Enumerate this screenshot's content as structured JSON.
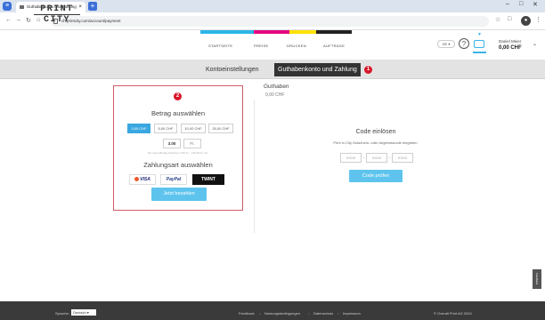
{
  "browser": {
    "tab_title": "Guthabenkonto und Zahlung",
    "tab_close": "×",
    "new_tab": "+",
    "menu_icon": "≡",
    "url": "ch.printcity.com/account/payment",
    "nav": {
      "back": "←",
      "forward": "→",
      "reload": "↻",
      "home": "⌂"
    },
    "star": "☆",
    "ext": "□",
    "profile_initial": "●",
    "more": "⋮",
    "win_min": "–",
    "win_max": "□",
    "win_close": "✕"
  },
  "header": {
    "logo_line1": "PRINT",
    "logo_line2": "CITY",
    "nav": [
      "STARTSEITE",
      "PREISE",
      "DRUCKEN",
      "AUFTRÄGE"
    ],
    "lang": "DE ▾",
    "help": "?",
    "cart_arrow": "▼",
    "user_name": "Daniel Meier",
    "user_balance": "0,00 CHF",
    "user_chevron": "⌄",
    "colors": {
      "cyan": "#29b6e8",
      "magenta": "#e5007e",
      "yellow": "#ffe100",
      "key": "#222222"
    }
  },
  "account_tabs": [
    {
      "label": "Kontoeinstellungen"
    },
    {
      "label": "Guthabenkonto und Zahlung"
    }
  ],
  "badges": {
    "one": "1",
    "two": "2"
  },
  "balance": {
    "title": "Guthaben",
    "value": "0,00 CHF"
  },
  "topup": {
    "title": "Betrag auswählen",
    "amounts": [
      "3,00 CHF",
      "5,00 CHF",
      "10,00 CHF",
      "25,00 CHF"
    ],
    "selected_index": 0,
    "custom_value": "3.00",
    "custom_unit": "Fr.",
    "hint": "Sie einen Betrag zwischen 3,00 Fr. - 100,00 Fr. ein.",
    "payment_title": "Zahlungsart auswählen",
    "payment_methods": [
      "VISA",
      "PayPal",
      "TWINT"
    ],
    "pay_button": "Jetzt bezahlen"
  },
  "voucher": {
    "title": "Code einlösen",
    "description": "Print in City Gutschein- oder Angebotscode eingeben.",
    "placeholders": [
      "XXXX",
      "XXXX",
      "XXXX"
    ],
    "dash": "-",
    "button": "Code prüfen"
  },
  "feedback_label": "Feedback",
  "footer": {
    "language_label": "Sprache:",
    "language_value": "Deutsch ▾",
    "links": [
      "Feedback",
      "Nutzungsbedingungen",
      "Datenschutz",
      "Impressum"
    ],
    "separator": "•",
    "copyright": "© Overall Print AG 2024"
  }
}
